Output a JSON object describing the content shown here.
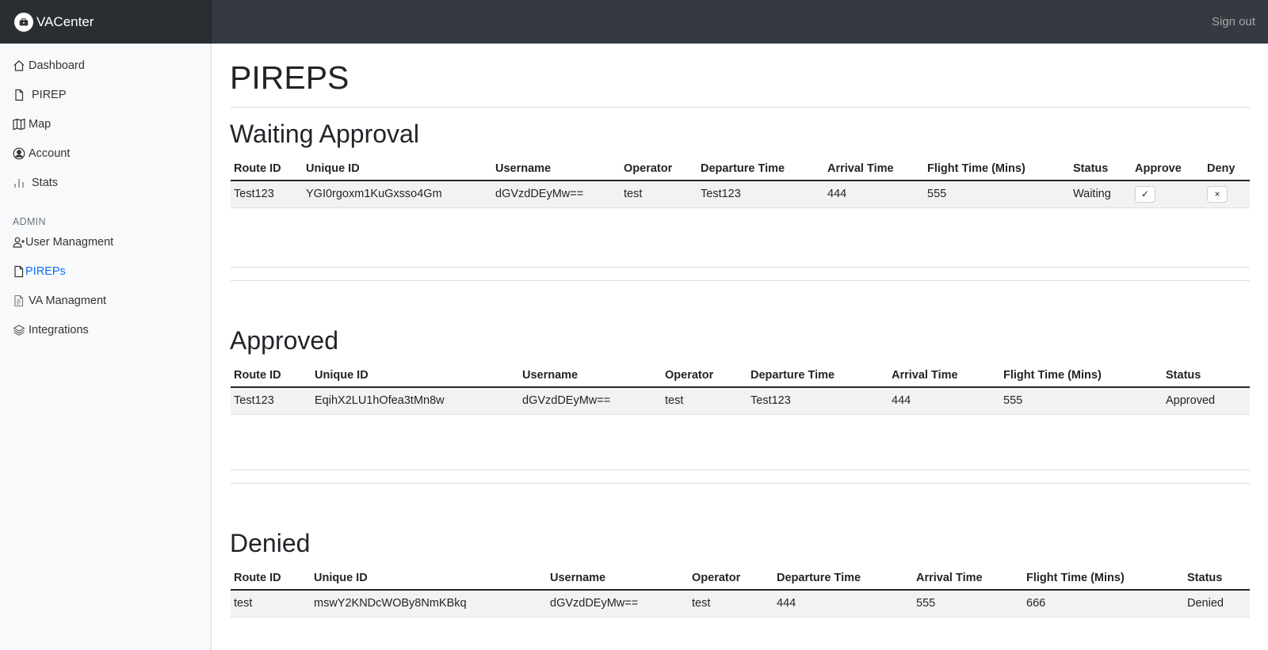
{
  "app": {
    "name": "VACenter"
  },
  "header": {
    "sign_out": "Sign out"
  },
  "sidebar": {
    "items": [
      {
        "label": "Dashboard",
        "icon": "house-icon"
      },
      {
        "label": "PIREP",
        "icon": "file-icon"
      },
      {
        "label": "Map",
        "icon": "map-icon"
      },
      {
        "label": "Account",
        "icon": "person-circle-icon"
      },
      {
        "label": "Stats",
        "icon": "bar-chart-icon"
      }
    ],
    "admin_heading": "ADMIN",
    "admin_items": [
      {
        "label": "User Managment",
        "icon": "person-plus-icon"
      },
      {
        "label": "PIREPs",
        "icon": "file-icon",
        "active": true
      },
      {
        "label": "VA Managment",
        "icon": "file-text-icon"
      },
      {
        "label": "Integrations",
        "icon": "layers-icon"
      }
    ]
  },
  "main": {
    "title": "PIREPS",
    "waiting": {
      "title": "Waiting Approval",
      "headers": [
        "Route ID",
        "Unique ID",
        "Username",
        "Operator",
        "Departure Time",
        "Arrival Time",
        "Flight Time (Mins)",
        "Status",
        "Approve",
        "Deny"
      ],
      "rows": [
        [
          "Test123",
          "YGI0rgoxm1KuGxsso4Gm",
          "dGVzdDEyMw==",
          "test",
          "Test123",
          "444",
          "555",
          "Waiting"
        ]
      ],
      "approve_symbol": "✓",
      "deny_symbol": "×"
    },
    "approved": {
      "title": "Approved",
      "headers": [
        "Route ID",
        "Unique ID",
        "Username",
        "Operator",
        "Departure Time",
        "Arrival Time",
        "Flight Time (Mins)",
        "Status"
      ],
      "rows": [
        [
          "Test123",
          "EqihX2LU1hOfea3tMn8w",
          "dGVzdDEyMw==",
          "test",
          "Test123",
          "444",
          "555",
          "Approved"
        ]
      ]
    },
    "denied": {
      "title": "Denied",
      "headers": [
        "Route ID",
        "Unique ID",
        "Username",
        "Operator",
        "Departure Time",
        "Arrival Time",
        "Flight Time (Mins)",
        "Status"
      ],
      "rows": [
        [
          "test",
          "mswY2KNDcWOBy8NmKBkq",
          "dGVzdDEyMw==",
          "test",
          "444",
          "555",
          "666",
          "Denied"
        ]
      ]
    }
  },
  "colors": {
    "topbar": "#343a40",
    "brand_bg": "#2a2e32",
    "sidebar_bg": "#f8f9fa",
    "accent": "#0d6efd"
  }
}
